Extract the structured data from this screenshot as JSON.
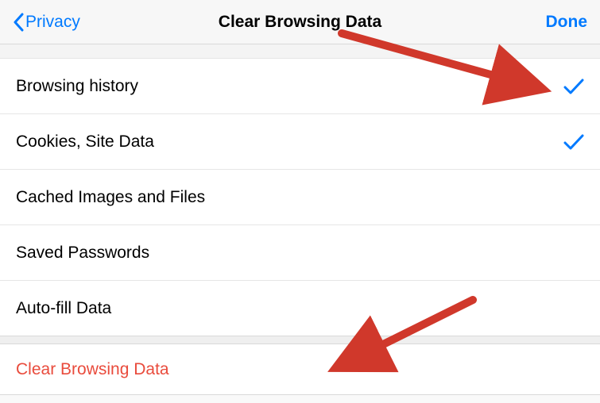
{
  "header": {
    "back_label": "Privacy",
    "title": "Clear Browsing Data",
    "done_label": "Done"
  },
  "items": [
    {
      "label": "Browsing history",
      "checked": true
    },
    {
      "label": "Cookies, Site Data",
      "checked": true
    },
    {
      "label": "Cached Images and Files",
      "checked": false
    },
    {
      "label": "Saved Passwords",
      "checked": false
    },
    {
      "label": "Auto-fill Data",
      "checked": false
    }
  ],
  "action": {
    "label": "Clear Browsing Data"
  },
  "colors": {
    "accent": "#007aff",
    "destructive": "#e94b3c",
    "annotation": "#d0382b"
  }
}
